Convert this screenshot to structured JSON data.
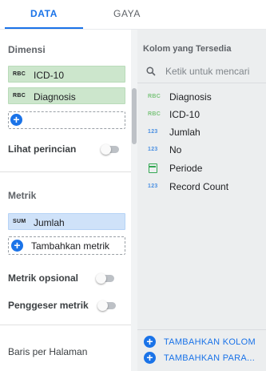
{
  "tabs": {
    "data": "DATA",
    "gaya": "GAYA"
  },
  "left": {
    "dimensi_title": "Dimensi",
    "dimensions": [
      {
        "type": "RBC",
        "label": "ICD-10"
      },
      {
        "type": "RBC",
        "label": "Diagnosis"
      }
    ],
    "lihat_perincian": "Lihat perincian",
    "metrik_title": "Metrik",
    "metrics": [
      {
        "type": "SUM",
        "label": "Jumlah"
      }
    ],
    "tambahkan_metrik": "Tambahkan metrik",
    "metrik_opsional": "Metrik opsional",
    "penggeser_metrik": "Penggeser metrik",
    "baris_per_halaman": "Baris per Halaman",
    "toggles": {
      "lihat_perincian": false,
      "metrik_opsional": false,
      "penggeser_metrik": false
    }
  },
  "right": {
    "title": "Kolom yang Tersedia",
    "search_placeholder": "Ketik untuk mencari",
    "fields": [
      {
        "type": "RBC",
        "label": "Diagnosis"
      },
      {
        "type": "RBC",
        "label": "ICD-10"
      },
      {
        "type": "123",
        "label": "Jumlah"
      },
      {
        "type": "123",
        "label": "No"
      },
      {
        "type": "date-icon",
        "label": "Periode"
      },
      {
        "type": "123",
        "label": "Record Count"
      }
    ],
    "add_field": "TAMBAHKAN KOLOM",
    "add_param": "TAMBAHKAN PARA..."
  },
  "colors": {
    "accent": "#1a73e8",
    "dimension_chip": "#cce6cc",
    "metric_chip": "#cfe2f9",
    "panel_bg": "#eceeef"
  }
}
